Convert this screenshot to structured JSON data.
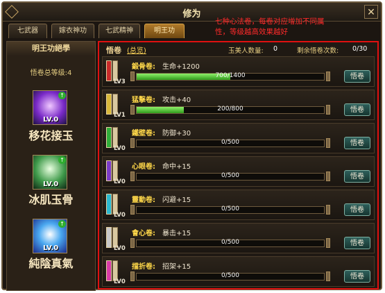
{
  "window": {
    "title": "修为"
  },
  "tabs": [
    {
      "label": "七武器",
      "active": false
    },
    {
      "label": "嫁衣神功",
      "active": false
    },
    {
      "label": "七武精神",
      "active": false
    },
    {
      "label": "明王功",
      "active": true
    }
  ],
  "annotation": "七种心法卷，每卷对应增加不同属性，等级越高效果越好",
  "left": {
    "header": "明王功絕學",
    "total_level": "悟卷总等级:4",
    "skills": [
      {
        "name": "移花接玉",
        "level": "LV.0",
        "icon": "flower-skill-icon"
      },
      {
        "name": "冰肌玉骨",
        "level": "LV.0",
        "icon": "dancer-skill-icon"
      },
      {
        "name": "純陰真氣",
        "level": "LV.0",
        "icon": "snowflake-skill-icon"
      }
    ]
  },
  "panel": {
    "title": "悟卷",
    "overview_link": "(总览)",
    "beauty_label": "玉美人数量:",
    "beauty_value": "0",
    "remaining_label": "剩余悟卷次数:",
    "remaining_value": "0/30",
    "button_label": "悟卷",
    "rows": [
      {
        "name": "鍛骨卷:",
        "stat": "生命+1200",
        "level": "LV3",
        "progress": "700/1400",
        "fraction": 0.5,
        "color": "#c82a2a"
      },
      {
        "name": "猛擊卷:",
        "stat": "攻击+40",
        "level": "LV1",
        "progress": "200/800",
        "fraction": 0.25,
        "color": "#d8b83a"
      },
      {
        "name": "鐵壁卷:",
        "stat": "防御+30",
        "level": "LV0",
        "progress": "0/500",
        "fraction": 0,
        "color": "#2fae3a"
      },
      {
        "name": "心眼卷:",
        "stat": "命中+15",
        "level": "LV0",
        "progress": "0/500",
        "fraction": 0,
        "color": "#7a3ac8"
      },
      {
        "name": "靈動卷:",
        "stat": "闪避+15",
        "level": "LV0",
        "progress": "0/500",
        "fraction": 0,
        "color": "#2ab8d0"
      },
      {
        "name": "會心卷:",
        "stat": "暴击+15",
        "level": "LV0",
        "progress": "0/500",
        "fraction": 0,
        "color": "#c8c8c8"
      },
      {
        "name": "擋折卷:",
        "stat": "招架+15",
        "level": "LV0",
        "progress": "0/500",
        "fraction": 0,
        "color": "#d83aa8"
      }
    ]
  }
}
